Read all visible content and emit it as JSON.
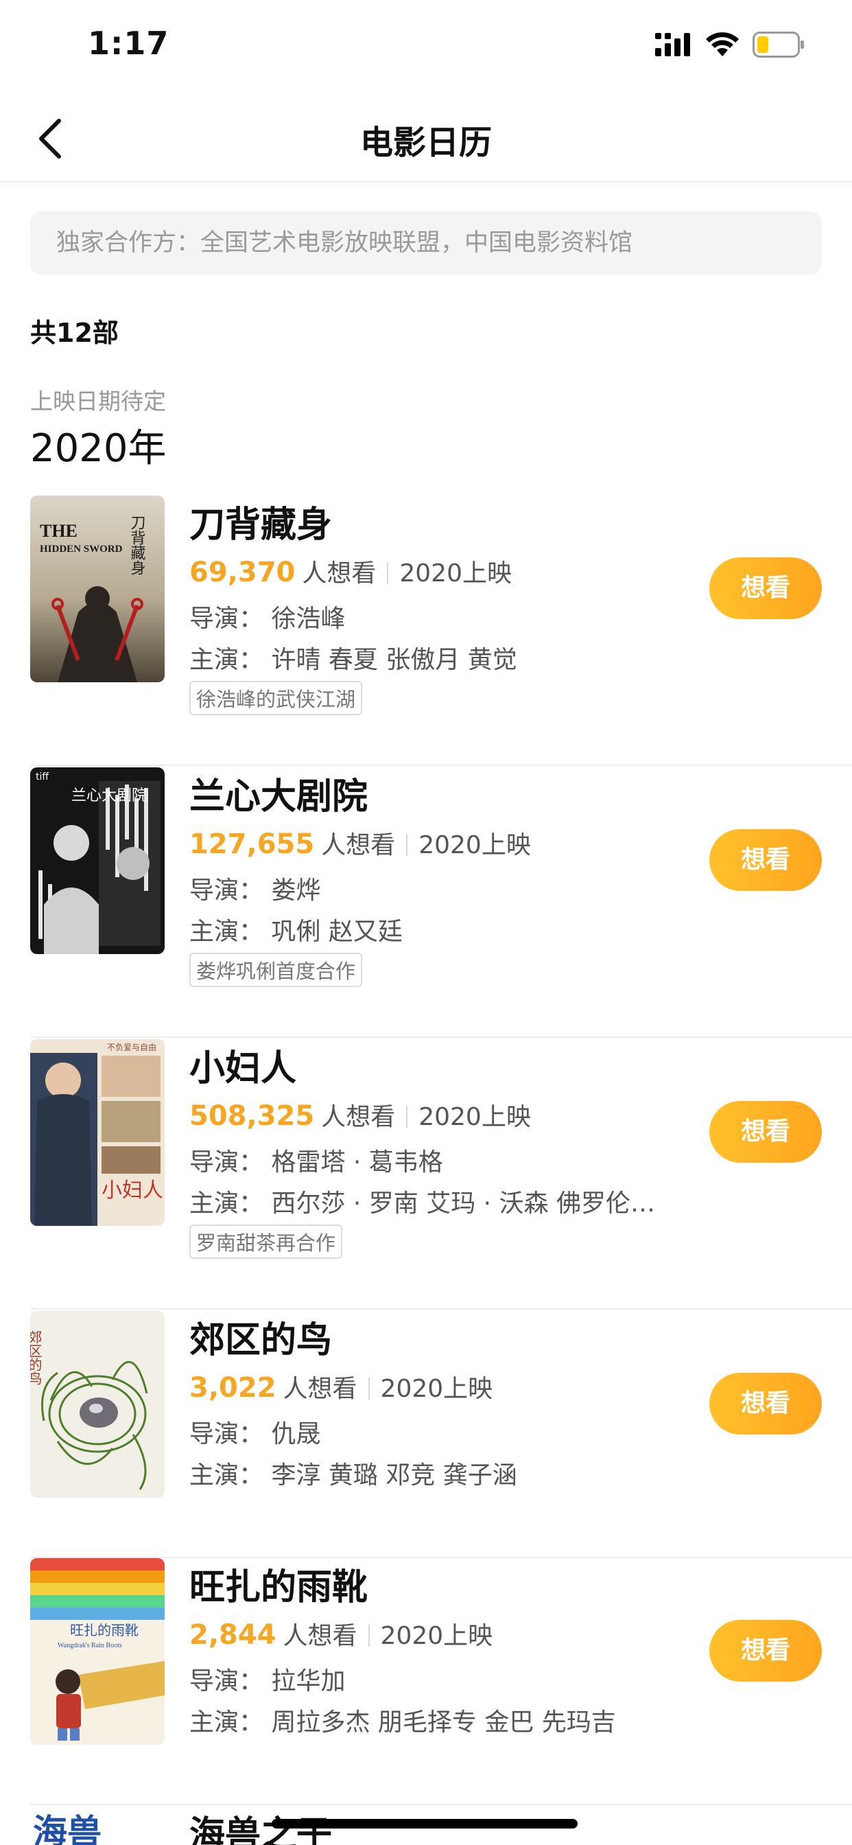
{
  "status_bar": {
    "time": "1:17"
  },
  "nav": {
    "title": "电影日历"
  },
  "partner_banner": "独家合作方：全国艺术电影放映联盟，中国电影资料馆",
  "total_count": "共12部",
  "section": {
    "date_note": "上映日期待定",
    "year": "2020年"
  },
  "button_label": "想看",
  "movies": [
    {
      "title": "刀背藏身",
      "want_count": "69,370",
      "want_label": "人想看",
      "release": "2020上映",
      "director": "导演：  徐浩峰",
      "cast": "主演：  许晴 春夏 张傲月 黄觉",
      "tag": "徐浩峰的武侠江湖",
      "poster": {
        "title_en_1": "THE",
        "title_en_2": "HIDDEN SWORD",
        "title_cn": "刀背藏身",
        "colors": [
          "#cfc7b8",
          "#6d6351",
          "#b31e1e"
        ]
      }
    },
    {
      "title": "兰心大剧院",
      "want_count": "127,655",
      "want_label": "人想看",
      "release": "2020上映",
      "director": "导演：  娄烨",
      "cast": "主演：  巩俐 赵又廷",
      "tag": "娄烨巩俐首度合作",
      "poster": {
        "title_cn": "兰心大剧院",
        "badge": "tiff",
        "colors": [
          "#1a1a1a",
          "#e9e9e9"
        ]
      }
    },
    {
      "title": "小妇人",
      "want_count": "508,325",
      "want_label": "人想看",
      "release": "2020上映",
      "director": "导演：  格雷塔 · 葛韦格",
      "cast": "主演：  西尔莎 · 罗南 艾玛 · 沃森 佛罗伦…",
      "tag": "罗南甜茶再合作",
      "poster": {
        "title_cn": "小妇人",
        "tagline": "不负爱与自由",
        "colors": [
          "#efe6d6",
          "#34425a",
          "#c0392b"
        ]
      }
    },
    {
      "title": "郊区的鸟",
      "want_count": "3,022",
      "want_label": "人想看",
      "release": "2020上映",
      "director": "导演：  仇晟",
      "cast": "主演：  李淳 黄璐 邓竞 龚子涵",
      "tag": "",
      "poster": {
        "title_cn": "郊区的鸟",
        "colors": [
          "#f2efe6",
          "#4f7d2c",
          "#9a3a2a"
        ]
      }
    },
    {
      "title": "旺扎的雨靴",
      "want_count": "2,844",
      "want_label": "人想看",
      "release": "2020上映",
      "director": "导演：  拉华加",
      "cast": "主演：  周拉多杰 朋毛择专 金巴 先玛吉",
      "tag": "",
      "poster": {
        "title_cn": "旺扎的雨靴",
        "title_en": "Wangdrak's Rain Boots",
        "colors": [
          "#f6f1e3",
          "#e6b64a",
          "#5a7ec4"
        ]
      }
    },
    {
      "title": "海兽之子",
      "poster": {
        "title_cn": "海兽"
      }
    }
  ]
}
